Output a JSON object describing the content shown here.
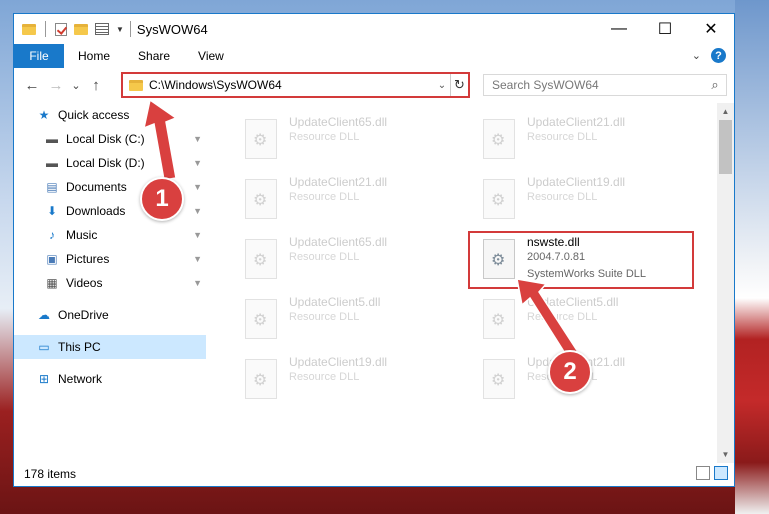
{
  "window": {
    "title": "SysWOW64",
    "minimize_glyph": "—",
    "maximize_glyph": "☐",
    "close_glyph": "✕"
  },
  "ribbon": {
    "tabs": [
      "File",
      "Home",
      "Share",
      "View"
    ],
    "expand_glyph": "⌄",
    "help_glyph": "?"
  },
  "nav": {
    "back_glyph": "←",
    "forward_glyph": "→",
    "recent_glyph": "⌄",
    "up_glyph": "↑",
    "address": "C:\\Windows\\SysWOW64",
    "address_drop_glyph": "⌄",
    "refresh_glyph": "↻",
    "search_placeholder": "Search SysWOW64",
    "search_glyph": "⌕"
  },
  "sidebar": {
    "items": [
      {
        "label": "Quick access",
        "icon": "star-icon",
        "glyph": "★",
        "color": "#1979ca"
      },
      {
        "label": "Local Disk (C:)",
        "icon": "drive-icon",
        "glyph": "▬",
        "color": "#555555",
        "pinned": true
      },
      {
        "label": "Local Disk (D:)",
        "icon": "drive-icon",
        "glyph": "▬",
        "color": "#555555",
        "pinned": true
      },
      {
        "label": "Documents",
        "icon": "documents-icon",
        "glyph": "▤",
        "color": "#4a7bb7",
        "pinned": true
      },
      {
        "label": "Downloads",
        "icon": "downloads-icon",
        "glyph": "⬇",
        "color": "#1979ca",
        "pinned": true
      },
      {
        "label": "Music",
        "icon": "music-icon",
        "glyph": "♪",
        "color": "#1979ca",
        "pinned": true
      },
      {
        "label": "Pictures",
        "icon": "pictures-icon",
        "glyph": "▣",
        "color": "#4a7bb7",
        "pinned": true
      },
      {
        "label": "Videos",
        "icon": "videos-icon",
        "glyph": "▦",
        "color": "#555555",
        "pinned": true
      },
      {
        "label": "OneDrive",
        "icon": "cloud-icon",
        "glyph": "☁",
        "color": "#1979ca"
      },
      {
        "label": "This PC",
        "icon": "computer-icon",
        "glyph": "▭",
        "color": "#1979ca"
      },
      {
        "label": "Network",
        "icon": "network-icon",
        "glyph": "⊞",
        "color": "#1979ca"
      }
    ],
    "pin_glyph": "📌"
  },
  "files": [
    {
      "name": "UpdateClient65.dll",
      "desc": "Resource DLL"
    },
    {
      "name": "UpdateClient21.dll",
      "desc": "Resource DLL"
    },
    {
      "name": "UpdateClient21.dll",
      "desc": "Resource DLL"
    },
    {
      "name": "UpdateClient19.dll",
      "desc": "Resource DLL"
    },
    {
      "name": "UpdateClient65.dll",
      "desc": "Resource DLL"
    },
    {
      "name": "nswste.dll",
      "version": "2004.7.0.81",
      "desc": "SystemWorks Suite DLL"
    },
    {
      "name": "UpdateClient5.dll",
      "desc": "Resource DLL"
    },
    {
      "name": "UpdateClient5.dll",
      "desc": "Resource DLL"
    },
    {
      "name": "UpdateClient19.dll",
      "desc": "Resource DLL"
    },
    {
      "name": "UpdateClient21.dll",
      "desc": "Resource DLL"
    }
  ],
  "status": {
    "item_count": "178 items"
  },
  "callouts": [
    "1",
    "2"
  ],
  "colors": {
    "accent": "#1979ca",
    "highlight": "#d33a3a",
    "callout": "#d9403f"
  }
}
